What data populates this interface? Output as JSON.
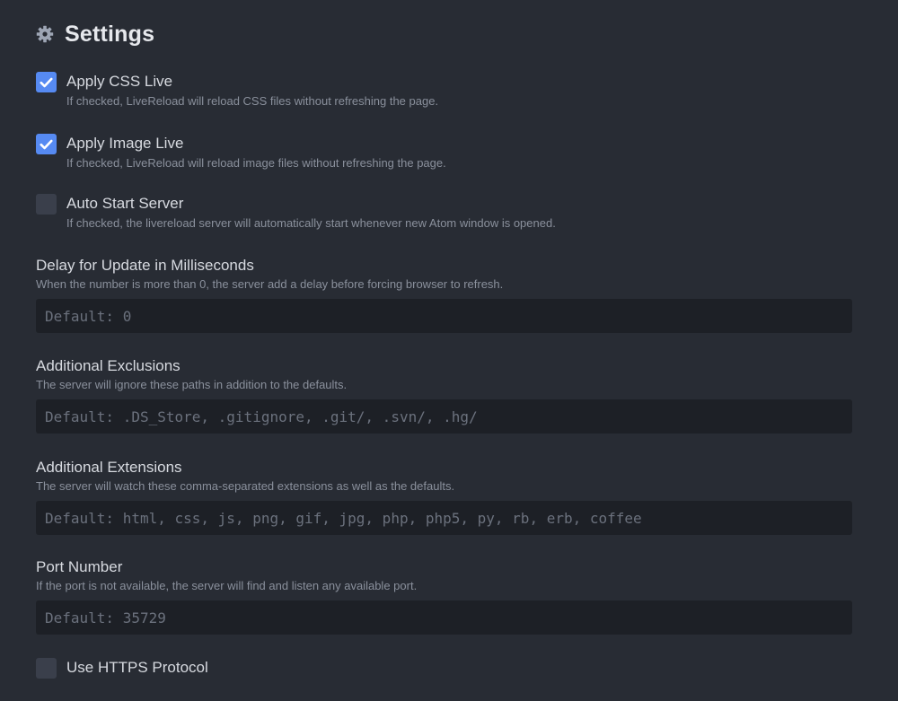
{
  "header": {
    "title": "Settings",
    "icon": "gear-icon"
  },
  "colors": {
    "background": "#282c34",
    "accent": "#568af2",
    "input_background": "#1d2026"
  },
  "settings": {
    "apply_css_live": {
      "label": "Apply CSS Live",
      "description": "If checked, LiveReload will reload CSS files without refreshing the page.",
      "checked": true
    },
    "apply_image_live": {
      "label": "Apply Image Live",
      "description": "If checked, LiveReload will reload image files without refreshing the page.",
      "checked": true
    },
    "auto_start_server": {
      "label": "Auto Start Server",
      "description": "If checked, the livereload server will automatically start whenever new Atom window is opened.",
      "checked": false
    },
    "delay": {
      "label": "Delay for Update in Milliseconds",
      "description": "When the number is more than 0, the server add a delay before forcing browser to refresh.",
      "value": "",
      "placeholder": "Default: 0"
    },
    "exclusions": {
      "label": "Additional Exclusions",
      "description": "The server will ignore these paths in addition to the defaults.",
      "value": "",
      "placeholder": "Default: .DS_Store, .gitignore, .git/, .svn/, .hg/"
    },
    "extensions": {
      "label": "Additional Extensions",
      "description": "The server will watch these comma-separated extensions as well as the defaults.",
      "value": "",
      "placeholder": "Default: html, css, js, png, gif, jpg, php, php5, py, rb, erb, coffee"
    },
    "port": {
      "label": "Port Number",
      "description": "If the port is not available, the server will find and listen any available port.",
      "value": "",
      "placeholder": "Default: 35729"
    },
    "use_https": {
      "label": "Use HTTPS Protocol",
      "checked": false
    }
  }
}
